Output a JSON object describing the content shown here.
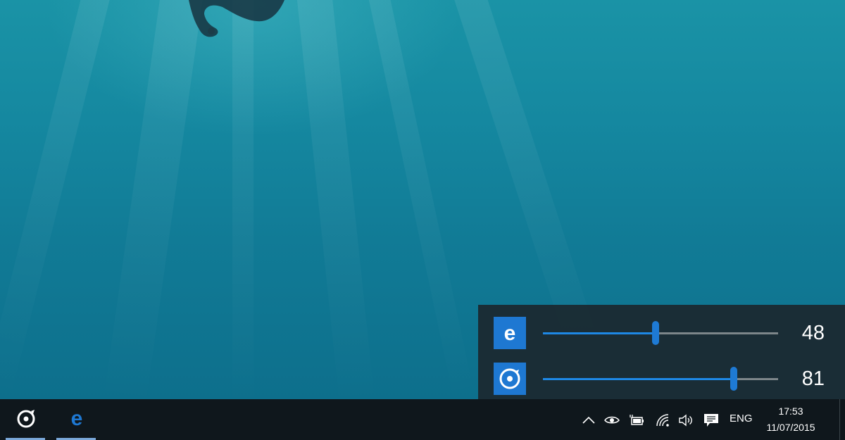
{
  "wallpaper": {
    "description_icon": "underwater-wallpaper"
  },
  "mixer": {
    "rows": [
      {
        "app_icon": "edge-icon",
        "volume": 48,
        "value_label": "48",
        "accent": "#1e78d2"
      },
      {
        "app_icon": "groove-music-icon",
        "volume": 81,
        "value_label": "81",
        "accent": "#1e78d2"
      }
    ]
  },
  "taskbar": {
    "pinned": [
      {
        "icon": "groove-music-icon",
        "active": true
      },
      {
        "icon": "edge-icon",
        "active": true
      }
    ],
    "tray": {
      "icons": [
        "chevron-up-icon",
        "eye-icon",
        "battery-plug-icon",
        "wifi-icon",
        "speaker-icon",
        "action-center-icon"
      ],
      "language": "ENG",
      "time": "17:53",
      "date": "11/07/2015"
    }
  },
  "colors": {
    "taskbar_bg": "#0f171c",
    "accent": "#1e78d2",
    "slider_fill": "#1e88e5",
    "mixer_bg": "#1c262c"
  }
}
